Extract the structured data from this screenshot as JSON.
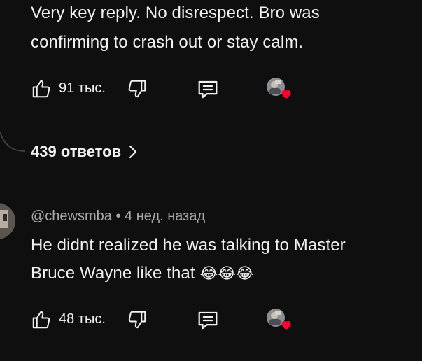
{
  "comment1": {
    "text_line1": "Very key reply. No disrespect. Bro was",
    "text_line2": "confirming to crash out or stay calm.",
    "likes": "91 тыс."
  },
  "replies_link": "439 ответов",
  "comment2": {
    "author": "@chewsmba",
    "separator": "•",
    "time": "4 нед. назад",
    "text_line1": "He didnt realized he was talking to Master",
    "text_line2": "Bruce Wayne like that",
    "emoji": "😂😂😂",
    "likes": "48 тыс."
  },
  "colors": {
    "background": "#0f0f0f",
    "text": "#f1f1f1",
    "meta": "#aaaaaa",
    "heart": "#ff0033"
  },
  "icons": [
    "like-icon",
    "dislike-icon",
    "reply-icon",
    "creator-avatar-icon",
    "heart-icon",
    "chevron-right-icon"
  ]
}
